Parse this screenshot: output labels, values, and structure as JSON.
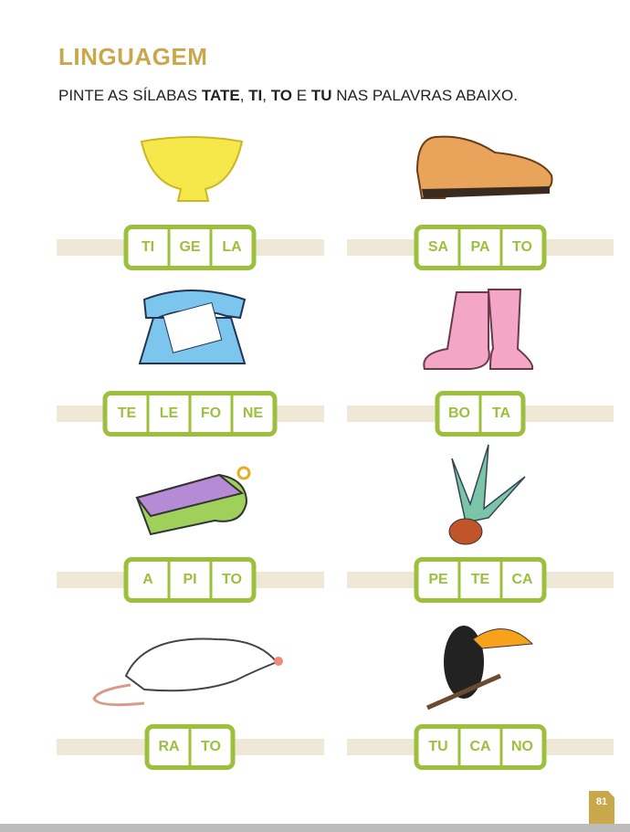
{
  "title": "LINGUAGEM",
  "instruction": {
    "pre": "PINTE AS SÍLABAS ",
    "s1": "TA",
    ", ": ", ",
    "s2": "TE",
    "s3": "TI",
    "s4": "TO",
    "e": " E ",
    "s5": "TU",
    "post": " NAS PALAVRAS ABAIXO."
  },
  "words": [
    {
      "picture": "bowl",
      "syllables": [
        "TI",
        "GE",
        "LA"
      ]
    },
    {
      "picture": "shoe",
      "syllables": [
        "SA",
        "PA",
        "TO"
      ]
    },
    {
      "picture": "telephone",
      "syllables": [
        "TE",
        "LE",
        "FO",
        "NE"
      ]
    },
    {
      "picture": "boots",
      "syllables": [
        "BO",
        "TA"
      ]
    },
    {
      "picture": "whistle",
      "syllables": [
        "A",
        "PI",
        "TO"
      ]
    },
    {
      "picture": "shuttlecock",
      "syllables": [
        "PE",
        "TE",
        "CA"
      ]
    },
    {
      "picture": "rat",
      "syllables": [
        "RA",
        "TO"
      ]
    },
    {
      "picture": "toucan",
      "syllables": [
        "TU",
        "CA",
        "NO"
      ]
    }
  ],
  "page_number": "81",
  "colors": {
    "title": "#c9a84c",
    "green": "#9cbf3c",
    "bar": "#efe8d6"
  }
}
